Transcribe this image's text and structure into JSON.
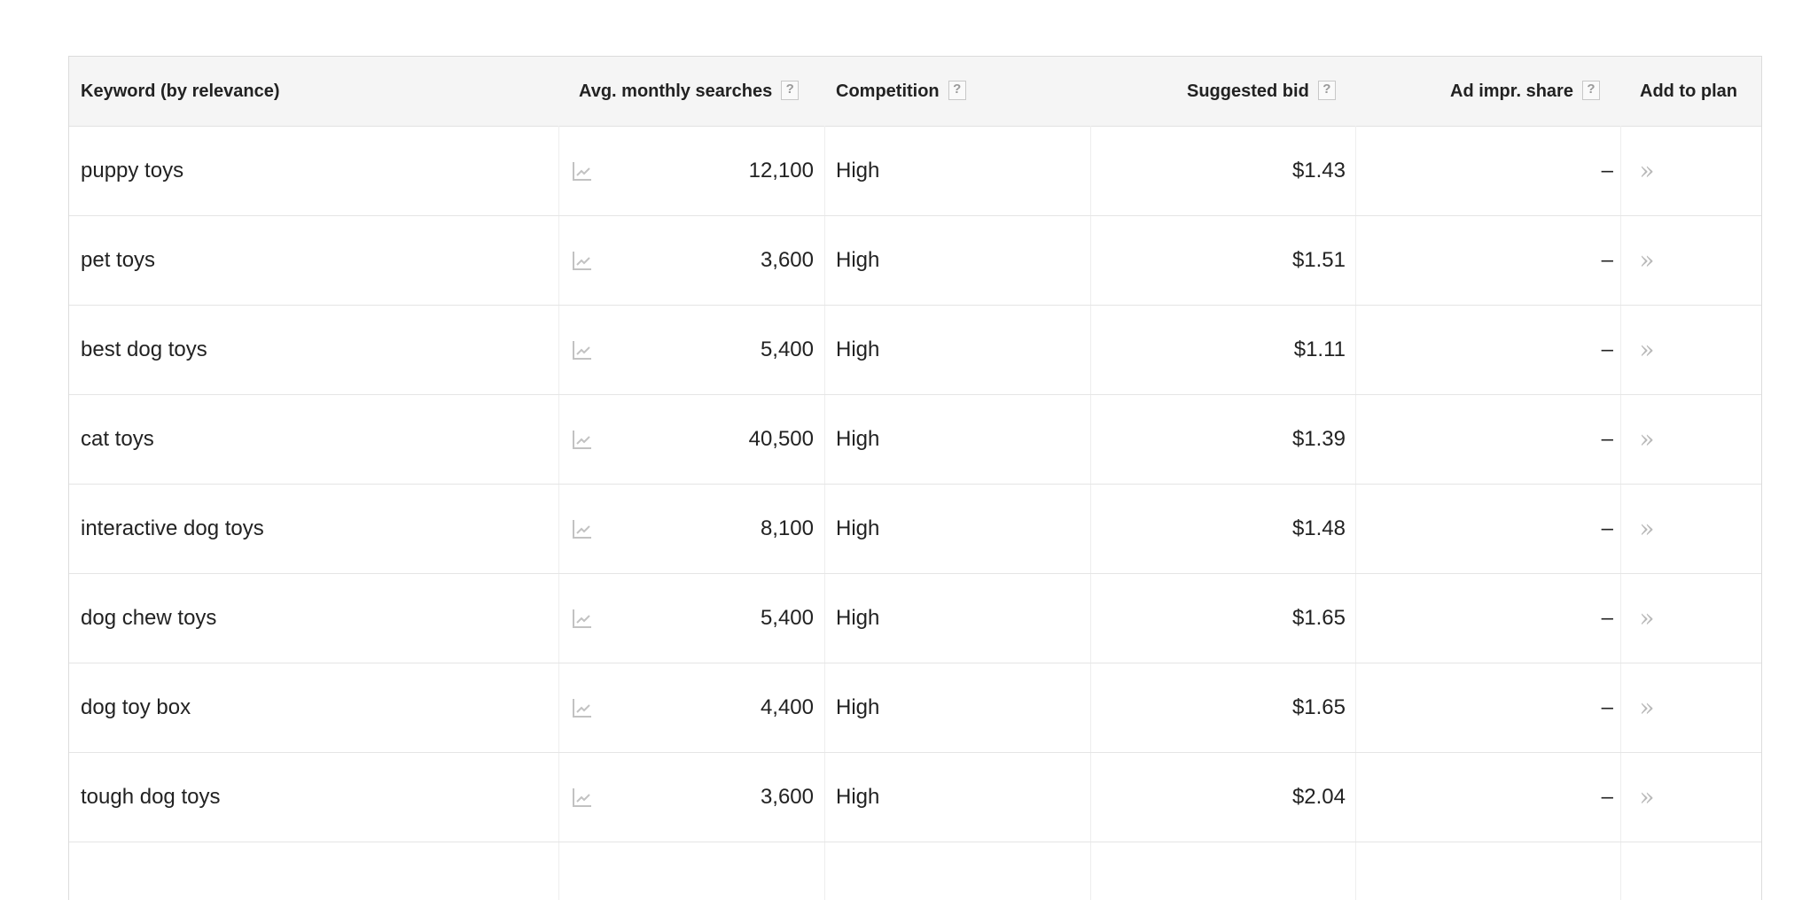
{
  "header": {
    "keyword": "Keyword (by relevance)",
    "avg_searches": "Avg. monthly searches",
    "competition": "Competition",
    "suggested_bid": "Suggested bid",
    "ad_impr_share": "Ad impr. share",
    "add_to_plan": "Add to plan",
    "help_glyph": "?"
  },
  "add_icon": "»",
  "rows": [
    {
      "keyword": "puppy toys",
      "searches": "12,100",
      "competition": "High",
      "bid": "$1.43",
      "share": "–"
    },
    {
      "keyword": "pet toys",
      "searches": "3,600",
      "competition": "High",
      "bid": "$1.51",
      "share": "–"
    },
    {
      "keyword": "best dog toys",
      "searches": "5,400",
      "competition": "High",
      "bid": "$1.11",
      "share": "–"
    },
    {
      "keyword": "cat toys",
      "searches": "40,500",
      "competition": "High",
      "bid": "$1.39",
      "share": "–"
    },
    {
      "keyword": "interactive dog toys",
      "searches": "8,100",
      "competition": "High",
      "bid": "$1.48",
      "share": "–"
    },
    {
      "keyword": "dog chew toys",
      "searches": "5,400",
      "competition": "High",
      "bid": "$1.65",
      "share": "–"
    },
    {
      "keyword": "dog toy box",
      "searches": "4,400",
      "competition": "High",
      "bid": "$1.65",
      "share": "–"
    },
    {
      "keyword": "tough dog toys",
      "searches": "3,600",
      "competition": "High",
      "bid": "$2.04",
      "share": "–"
    }
  ],
  "colors": {
    "header_bg": "#f5f5f5",
    "border": "#dcdcdc",
    "muted_icon": "#b9b9b9"
  }
}
